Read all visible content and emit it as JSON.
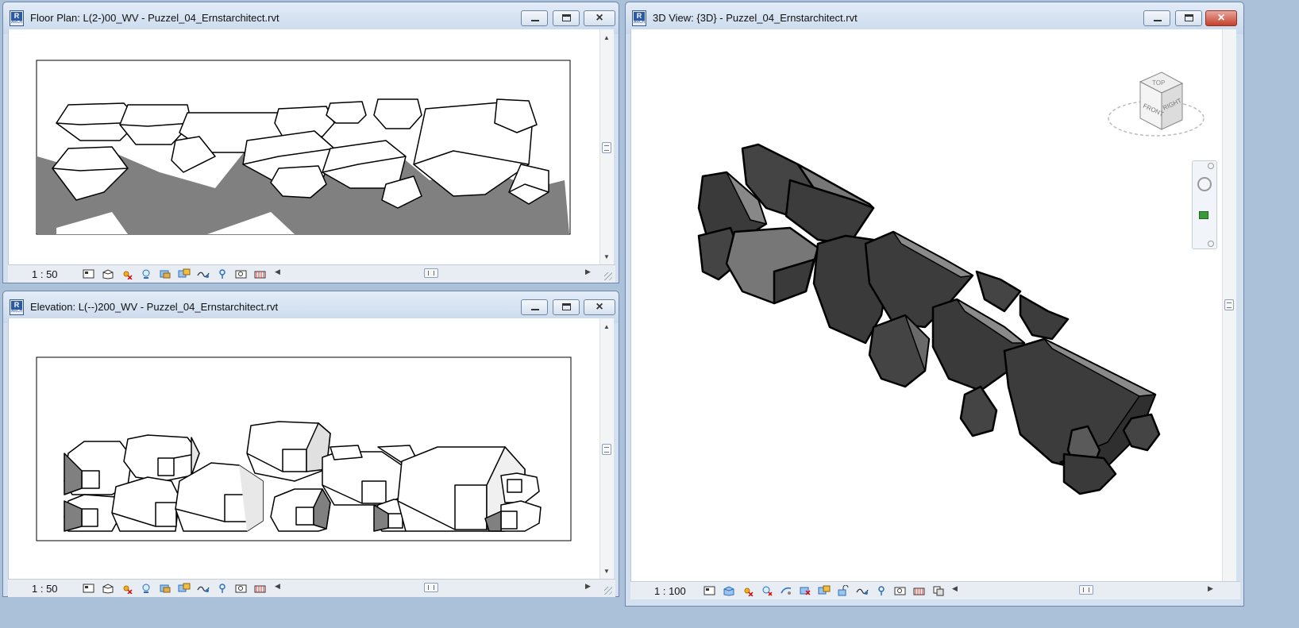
{
  "windows": [
    {
      "id": "floor-plan",
      "title": "Floor Plan: L(2-)00_WV - Puzzel_04_Ernstarchitect.rvt",
      "scale": "1 : 50"
    },
    {
      "id": "elevation",
      "title": "Elevation: L(--)200_WV - Puzzel_04_Ernstarchitect.rvt",
      "scale": "1 : 50"
    },
    {
      "id": "3d-view",
      "title": "3D View: {3D} - Puzzel_04_Ernstarchitect.rvt",
      "scale": "1 : 100"
    }
  ],
  "viewcube": {
    "top": "TOP",
    "front": "FRONT",
    "right": "RIGHT"
  },
  "app_icon": {
    "letter": "R",
    "sub": "ARCH"
  },
  "colors": {
    "chrome": "#d3e0ef",
    "titlebar": "#c9d9ec",
    "close_active": "#c3422e",
    "shadow_fill": "#808080",
    "solid_dark": "#404040",
    "solid_light": "#8a8a8a"
  }
}
